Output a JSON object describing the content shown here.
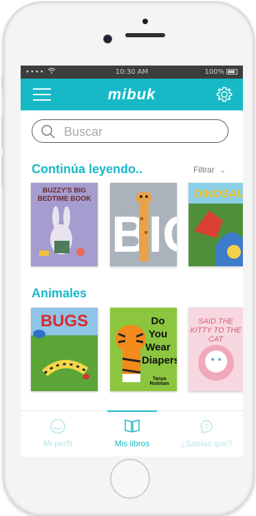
{
  "status_bar": {
    "signal": "•••• ",
    "time": "10:30 AM",
    "battery": "100%"
  },
  "app_bar": {
    "logo": "mibuk",
    "menu_icon": "menu-icon",
    "settings_icon": "gear-icon"
  },
  "search": {
    "placeholder": "Buscar"
  },
  "continue_section": {
    "title": "Continúa leyendo..",
    "filter_label": "Filtrar",
    "books": [
      {
        "title": "BUZZY'S BIG BEDTIME BOOK",
        "cover_color": "#a59ccf"
      },
      {
        "title": "BIG",
        "cover_color": "#8e9aa8"
      },
      {
        "title": "DINOSAUR",
        "cover_color": "#3b7d2e"
      }
    ]
  },
  "animals_section": {
    "title": "Animales",
    "books": [
      {
        "title": "BUGS",
        "cover_color": "#3f8f2d"
      },
      {
        "title": "Do You Wear Diapers?",
        "subtitle": "Tanya Roitman",
        "cover_color": "#8cc63f"
      },
      {
        "title": "SAID THE KITTY TO THE CAT",
        "cover_color": "#f2b8c6"
      }
    ]
  },
  "tabs": [
    {
      "label": "Mi perfil",
      "icon": "smiley-icon",
      "active": false
    },
    {
      "label": "Mis libros",
      "icon": "book-icon",
      "active": true
    },
    {
      "label": "¿Sabías que?",
      "icon": "question-icon",
      "active": false
    }
  ],
  "colors": {
    "accent": "#17b9c7"
  }
}
